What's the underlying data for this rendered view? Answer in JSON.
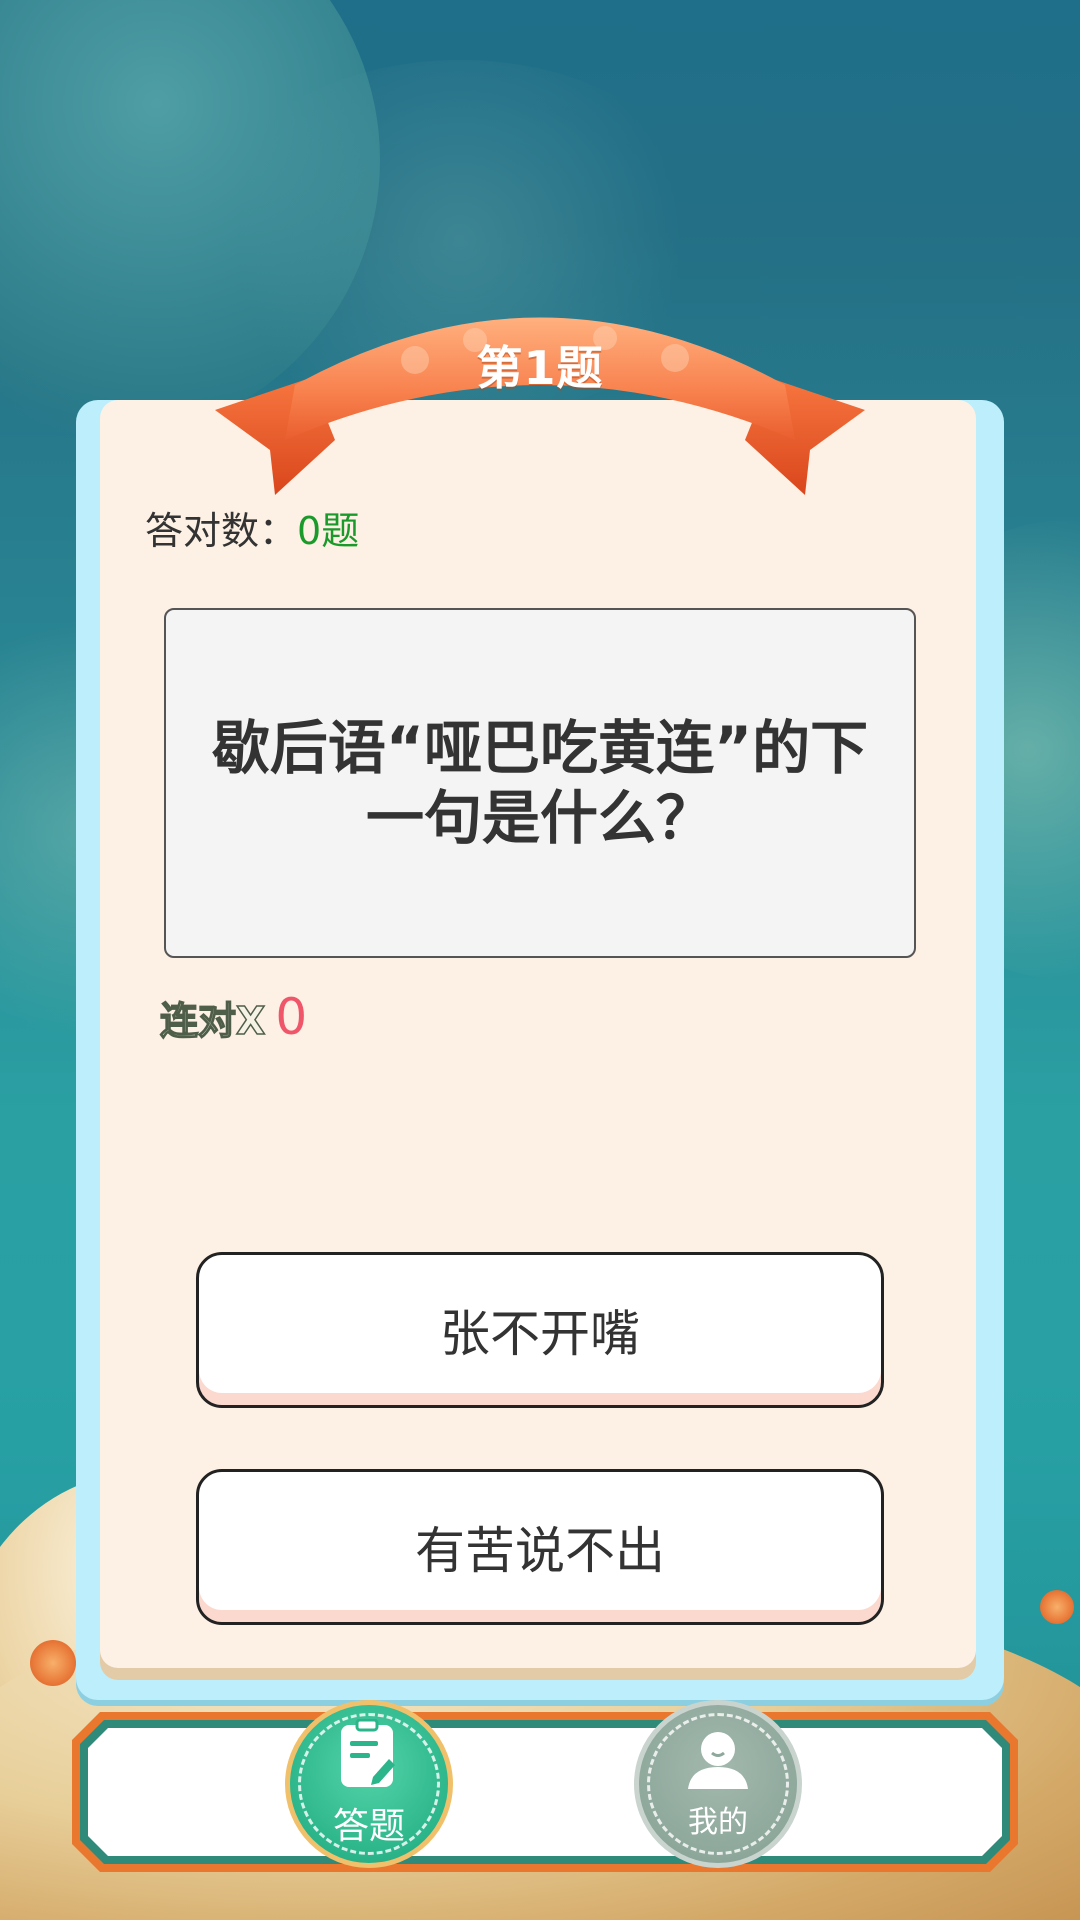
{
  "question_header": {
    "title": "第1题"
  },
  "score": {
    "label": "答对数：",
    "value": "0题"
  },
  "question": {
    "text": "歇后语“哑巴吃黄连”的下一句是什么？"
  },
  "streak": {
    "label": "连对X",
    "count": "0"
  },
  "options": [
    {
      "text": "张不开嘴"
    },
    {
      "text": "有苦说不出"
    }
  ],
  "bottom_nav": {
    "items": [
      {
        "label": "答题",
        "icon": "clipboard-pen-icon",
        "active": true
      },
      {
        "label": "我的",
        "icon": "user-icon",
        "active": false
      }
    ]
  },
  "colors": {
    "ribbon": "#f36d3b",
    "card_border": "#bdeefc",
    "card_bg": "#fdf0e4",
    "correct_count": "#1a9a2a",
    "streak_count": "#f0566a",
    "nav_active": "#2cb58a",
    "nav_inactive": "#8ea89c",
    "nav_frame": "#e9772e"
  }
}
